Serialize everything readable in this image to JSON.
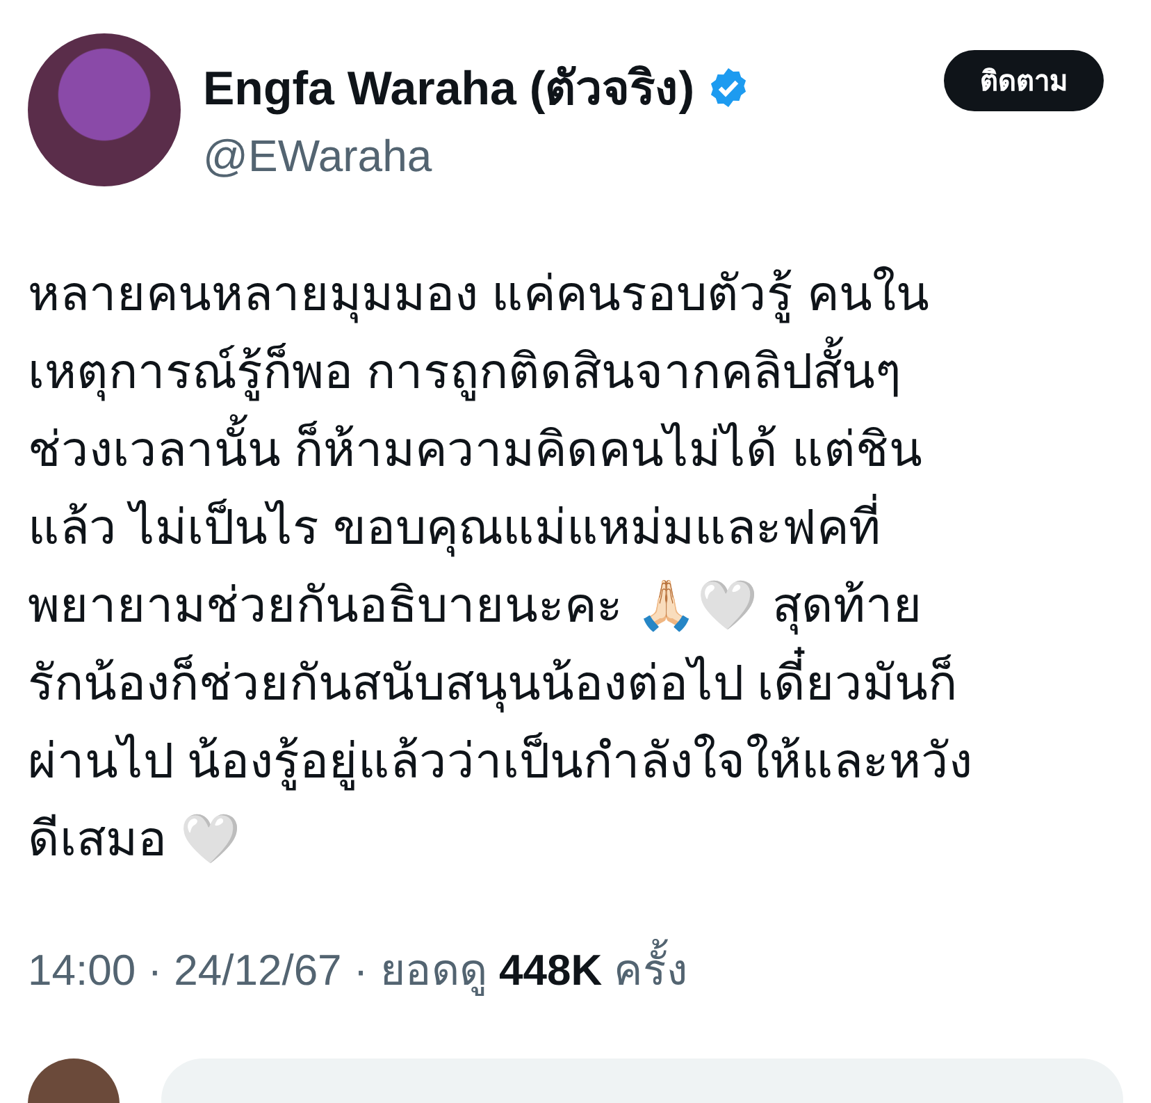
{
  "author": {
    "name": "Engfa Waraha (ตัวจริง)",
    "verified": true,
    "handle": "@EWaraha"
  },
  "follow_button": "ติดตาม",
  "body": "หลายคนหลายมุมมอง แค่คนรอบตัวรู้ คนใน\nเหตุการณ์รู้ก็พอ การถูกติดสินจากคลิปสั้นๆ\nช่วงเวลานั้น ก็ห้ามความคิดคนไม่ได้ แต่ชิน\nแล้ว ไม่เป็นไร ขอบคุณแม่แหม่มและฟคที่\nพยายามช่วยกันอธิบายนะคะ 🙏🏻🤍  สุดท้าย\nรักน้องก็ช่วยกันสนับสนุนน้องต่อไป เดี๋ยวมันก็\nผ่านไป น้องรู้อยู่แล้วว่าเป็นกำลังใจให้และหวัง\nดีเสมอ 🤍",
  "meta": "14:00 · 24/12/67 · ยอดดู **448K** ครั้ง"
}
